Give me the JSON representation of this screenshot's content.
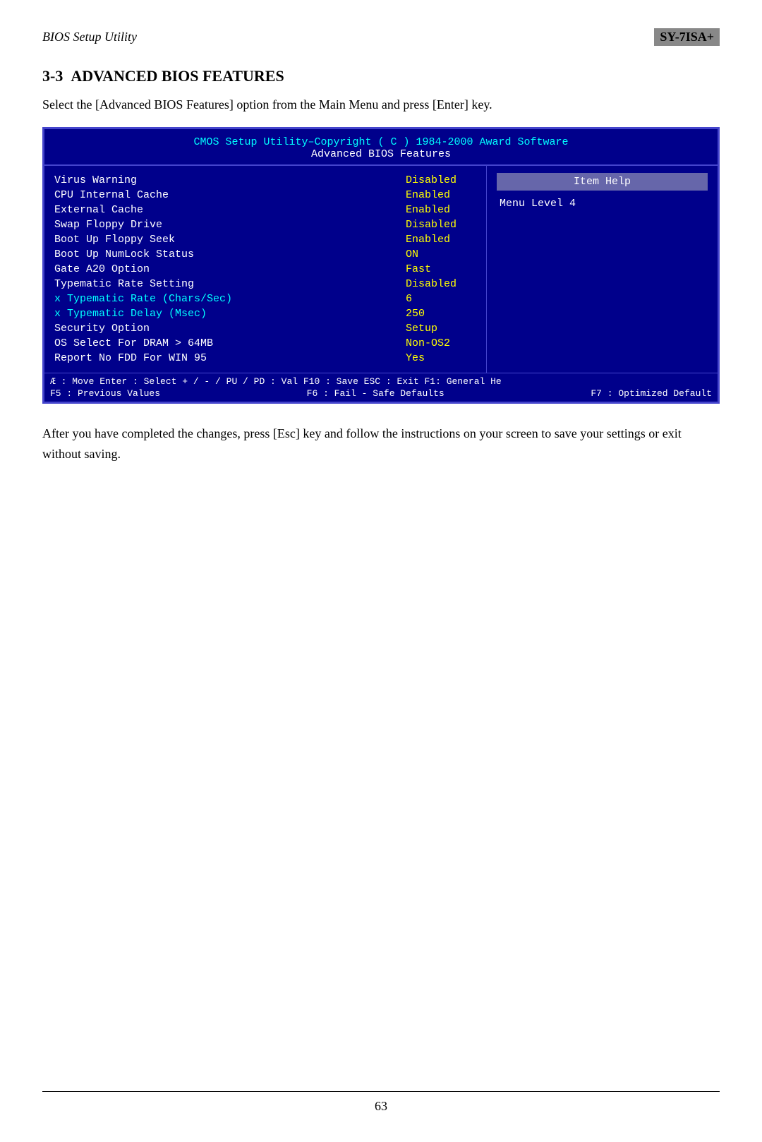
{
  "header": {
    "left": "BIOS Setup Utility",
    "right": "SY-7ISA+"
  },
  "section": {
    "number": "3-3",
    "title": "ADVANCED BIOS FEATURES",
    "intro": "Select the [Advanced BIOS Features] option from the Main Menu and press [Enter] key."
  },
  "bios": {
    "header_line1": "CMOS Setup Utility–Copyright ( C ) 1984-2000 Award Software",
    "header_line2": "Advanced BIOS Features",
    "rows": [
      {
        "label": "Virus Warning",
        "value": "Disabled",
        "label_cyan": false
      },
      {
        "label": "CPU Internal Cache",
        "value": "Enabled",
        "label_cyan": false
      },
      {
        "label": "External Cache",
        "value": "Enabled",
        "label_cyan": false
      },
      {
        "label": "Swap Floppy Drive",
        "value": "Disabled",
        "label_cyan": false
      },
      {
        "label": "Boot Up Floppy Seek",
        "value": "Enabled",
        "label_cyan": false
      },
      {
        "label": "Boot Up NumLock Status",
        "value": "ON",
        "label_cyan": false
      },
      {
        "label": "Gate A20 Option",
        "value": "Fast",
        "label_cyan": false
      },
      {
        "label": "Typematic Rate Setting",
        "value": "Disabled",
        "label_cyan": false
      },
      {
        "label": "x Typematic Rate (Chars/Sec)",
        "value": "6",
        "label_cyan": true
      },
      {
        "label": "x Typematic Delay (Msec)",
        "value": "250",
        "label_cyan": true
      },
      {
        "label": "Security Option",
        "value": "Setup",
        "label_cyan": false
      },
      {
        "label": "OS Select For DRAM > 64MB",
        "value": "Non-OS2",
        "label_cyan": false
      },
      {
        "label": "Report No FDD For WIN 95",
        "value": "Yes",
        "label_cyan": false
      }
    ],
    "help": {
      "title": "Item Help",
      "menu_level": "Menu Level  4"
    },
    "footer_row1": "Æ  : Move  Enter : Select + / - / PU / PD : Val F10 : Save ESC : Exit F1: General He",
    "footer_cols": [
      "F5 : Previous Values",
      "F6 : Fail - Safe Defaults",
      "F7 : Optimized Default"
    ]
  },
  "outro": "After you have completed the changes, press [Esc] key and follow the instructions on your screen to save your settings or exit without saving.",
  "page_number": "63"
}
